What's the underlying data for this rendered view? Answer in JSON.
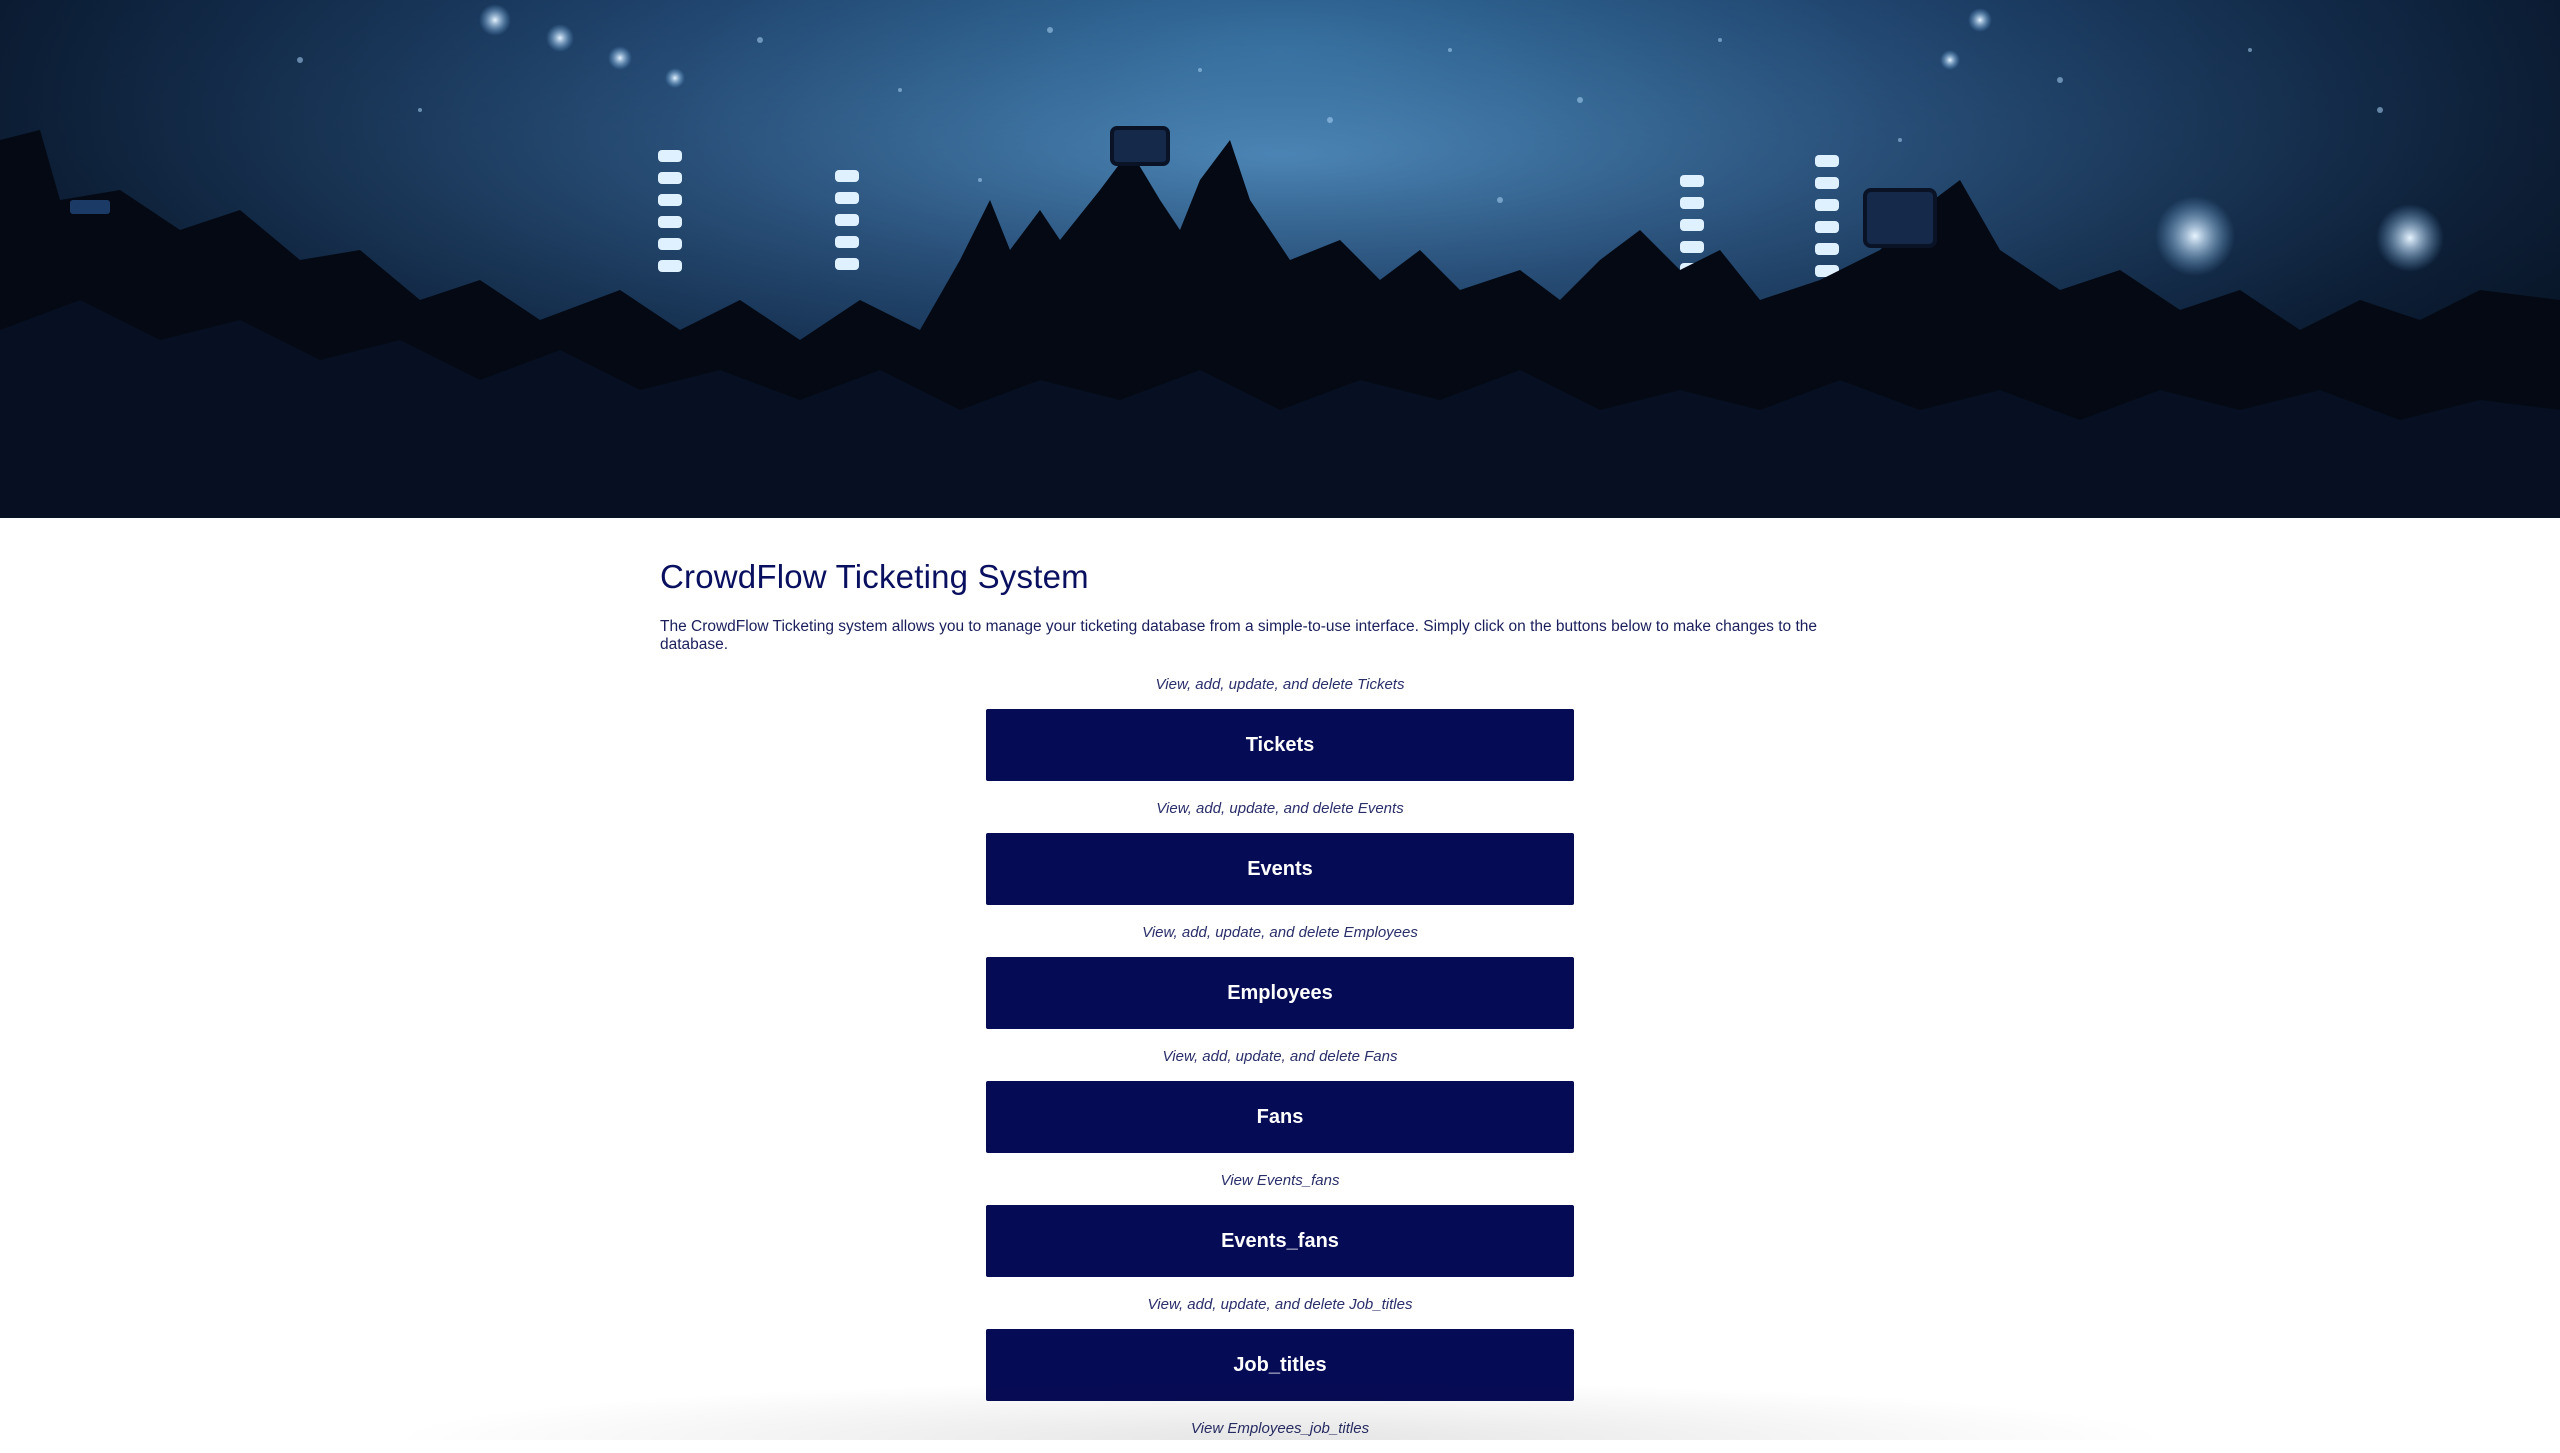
{
  "hero": {
    "image": "concert-crowd-banner",
    "colors": {
      "accent": "#2f6fa3",
      "dark": "#050b16"
    }
  },
  "header": {
    "title": "CrowdFlow Ticketing System",
    "intro": "The CrowdFlow Ticketing system allows you to manage your ticketing database from a simple-to-use interface. Simply click on the buttons below to make changes to the database."
  },
  "menu": [
    {
      "hint": "View, add, update, and delete Tickets",
      "label": "Tickets"
    },
    {
      "hint": "View, add, update, and delete Events",
      "label": "Events"
    },
    {
      "hint": "View, add, update, and delete Employees",
      "label": "Employees"
    },
    {
      "hint": "View, add, update, and delete Fans",
      "label": "Fans"
    },
    {
      "hint": "View Events_fans",
      "label": "Events_fans"
    },
    {
      "hint": "View, add, update, and delete Job_titles",
      "label": "Job_titles"
    },
    {
      "hint": "View Employees_job_titles",
      "label": ""
    }
  ],
  "colors": {
    "button_bg": "#060b55",
    "button_text": "#ffffff",
    "title_text": "#0a1060"
  }
}
